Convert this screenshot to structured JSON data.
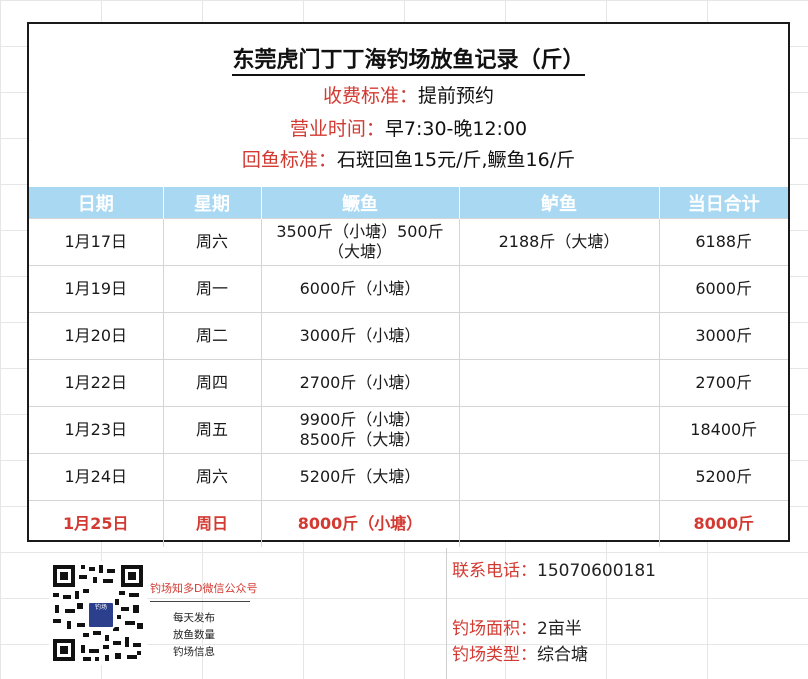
{
  "header": {
    "title": "东莞虎门丁丁海钓场放鱼记录（斤）",
    "fee_label": "收费标准：",
    "fee_value": "提前预约",
    "hours_label": "营业时间：",
    "hours_value": "早7:30-晚12:00",
    "return_label": "回鱼标准：",
    "return_value": "石斑回鱼15元/斤,鳜鱼16/斤"
  },
  "table": {
    "columns": [
      "日期",
      "星期",
      "鳜鱼",
      "鲈鱼",
      "当日合计"
    ],
    "rows": [
      {
        "date": "1月17日",
        "weekday": "周六",
        "guiyu_1": "3500斤（小塘）500斤",
        "guiyu_2": "（大塘）",
        "luyu": "2188斤（大塘）",
        "total": "6188斤"
      },
      {
        "date": "1月19日",
        "weekday": "周一",
        "guiyu_1": "6000斤（小塘）",
        "guiyu_2": "",
        "luyu": "",
        "total": "6000斤"
      },
      {
        "date": "1月20日",
        "weekday": "周二",
        "guiyu_1": "3000斤（小塘）",
        "guiyu_2": "",
        "luyu": "",
        "total": "3000斤"
      },
      {
        "date": "1月22日",
        "weekday": "周四",
        "guiyu_1": "2700斤（小塘）",
        "guiyu_2": "",
        "luyu": "",
        "total": "2700斤"
      },
      {
        "date": "1月23日",
        "weekday": "周五",
        "guiyu_1": "9900斤（小塘）",
        "guiyu_2": "8500斤（大塘）",
        "luyu": "",
        "total": "18400斤"
      },
      {
        "date": "1月24日",
        "weekday": "周六",
        "guiyu_1": "5200斤（大塘）",
        "guiyu_2": "",
        "luyu": "",
        "total": "5200斤"
      },
      {
        "date": "1月25日",
        "weekday": "周日",
        "guiyu_1": "8000斤（小塘）",
        "guiyu_2": "",
        "luyu": "",
        "total": "8000斤",
        "highlight": true
      }
    ]
  },
  "footer": {
    "qr_logo_text": "钓场",
    "wechat_name": "钓场知多D微信公众号",
    "wechat_desc_1": "每天发布",
    "wechat_desc_2": "放鱼数量",
    "wechat_desc_3": "钓场信息",
    "phone_label": "联系电话：",
    "phone_value": "15070600181",
    "area_label": "钓场面积：",
    "area_value": "2亩半",
    "type_label": "钓场类型：",
    "type_value": "综合塘"
  },
  "colors": {
    "accent_red": "#d23a32",
    "header_blue": "#a9d8f2",
    "qr_logo": "#2c3f8c"
  }
}
